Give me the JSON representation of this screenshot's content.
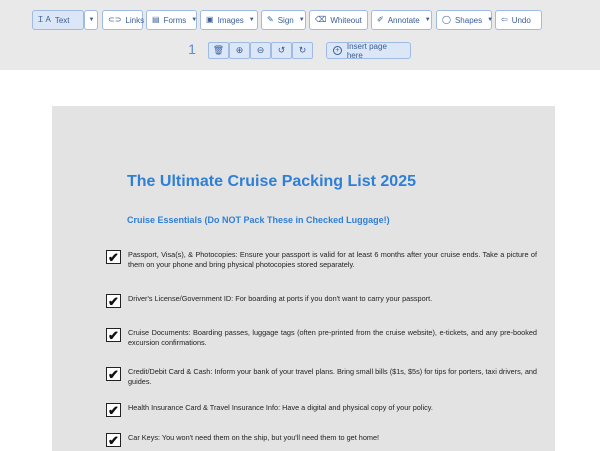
{
  "toolbar": {
    "text_label": "Text",
    "links_label": "Links",
    "forms_label": "Forms",
    "images_label": "Images",
    "sign_label": "Sign",
    "whiteout_label": "Whiteout",
    "annotate_label": "Annotate",
    "shapes_label": "Shapes",
    "undo_label": "Undo"
  },
  "page_controls": {
    "page_number": "1",
    "insert_label": "Insert page here"
  },
  "document": {
    "title": "The Ultimate Cruise Packing List 2025",
    "subtitle": "Cruise Essentials (Do NOT Pack These in Checked Luggage!)",
    "check_mark": "✔",
    "items": [
      "Passport, Visa(s), & Photocopies: Ensure your passport is valid for at least 6 months after your cruise ends. Take a picture of them on your phone and bring physical photocopies stored separately.",
      "Driver's License/Government ID: For boarding at ports if you don't want to carry your passport.",
      "Cruise Documents: Boarding passes, luggage tags (often pre-printed from the cruise website), e-tickets, and any pre-booked excursion confirmations.",
      "Credit/Debit Card & Cash: Inform your bank of your travel plans. Bring small bills ($1s, $5s) for tips for porters, taxi drivers, and guides.",
      "Health Insurance Card & Travel Insurance Info: Have a digital and physical copy of your policy.",
      "Car Keys: You won't need them on the ship, but you'll need them to get home!"
    ]
  },
  "colors": {
    "accent": "#2e7fd6",
    "toolbar_text": "#3a5d98",
    "button_border": "#9fbbe3"
  }
}
